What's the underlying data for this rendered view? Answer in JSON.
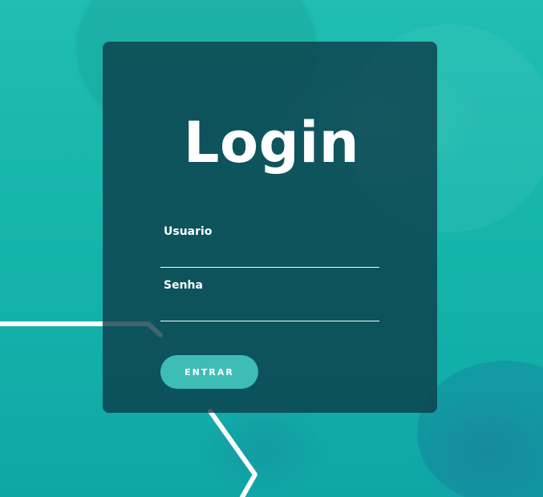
{
  "login": {
    "title": "Login",
    "username_label": "Usuario",
    "username_value": "",
    "password_label": "Senha",
    "password_value": "",
    "submit_label": "ENTRAR"
  },
  "colors": {
    "background": "#16b4ab",
    "card": "rgba(12,56,70,0.78)",
    "button": "#3ebdb6",
    "text": "#ffffff"
  }
}
